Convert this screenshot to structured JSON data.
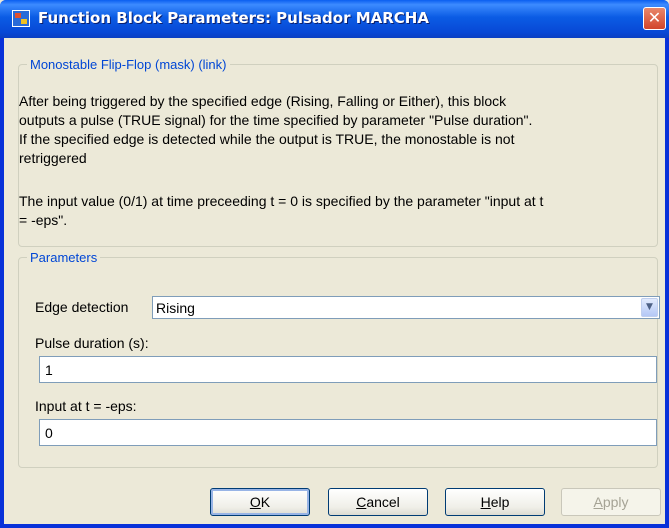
{
  "window": {
    "title": "Function Block Parameters: Pulsador MARCHA",
    "close_glyph": "✕"
  },
  "description": {
    "legend": "Monostable Flip-Flop (mask) (link)",
    "paragraph1_lines": [
      "After being triggered  by the specified edge (Rising, Falling or Either), this block",
      "outputs a pulse (TRUE signal) for the time specified by parameter \"Pulse duration\".",
      "If the specified edge is detected while the output is TRUE, the monostable is not",
      "retriggered"
    ],
    "paragraph2_lines": [
      "The input value (0/1) at time preceeding t = 0 is specified by the parameter \"input at t",
      "= -eps\"."
    ]
  },
  "parameters": {
    "legend": "Parameters",
    "edge_detection": {
      "label": "Edge detection",
      "value": "Rising"
    },
    "pulse_duration": {
      "label": "Pulse duration (s):",
      "value": "1"
    },
    "input_at_eps": {
      "label": "Input at t = -eps:",
      "value": "0"
    }
  },
  "buttons": {
    "ok": {
      "mnemonic": "O",
      "rest": "K"
    },
    "cancel": {
      "mnemonic": "C",
      "rest": "ancel"
    },
    "help": {
      "mnemonic": "H",
      "rest": "elp"
    },
    "apply": {
      "mnemonic": "A",
      "rest": "pply"
    }
  },
  "icons": {
    "app": "simulink-block-icon",
    "close": "close-icon",
    "dropdown": "chevron-down-icon"
  },
  "colors": {
    "titlebar": "#0b5ce4",
    "close_button": "#d2452a",
    "legend_text": "#0046d5",
    "dialog_bg": "#ece9d8"
  }
}
